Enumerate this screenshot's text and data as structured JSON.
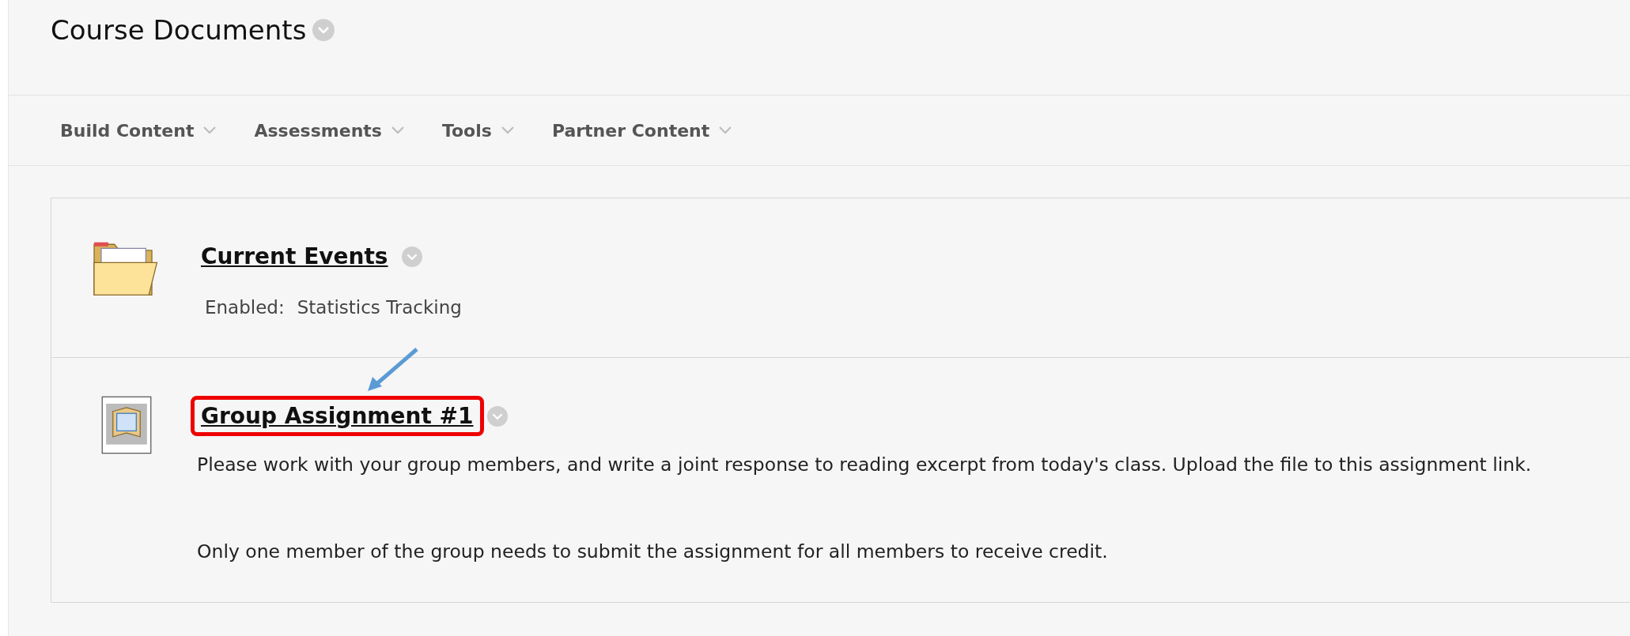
{
  "page_title": "Course Documents",
  "menu": [
    {
      "label": "Build Content"
    },
    {
      "label": "Assessments"
    },
    {
      "label": "Tools"
    },
    {
      "label": "Partner Content"
    }
  ],
  "items": [
    {
      "kind": "folder",
      "title": "Current Events",
      "highlighted": false,
      "details": [
        {
          "label": "Enabled:",
          "value": "Statistics Tracking"
        }
      ]
    },
    {
      "kind": "assignment",
      "title": "Group Assignment #1",
      "highlighted": true,
      "paragraphs": [
        "Please work with your group members, and write a joint response to reading excerpt from today's class.  Upload the file to this assignment link.",
        "Only one member of the group needs to submit the assignment for all members to receive credit."
      ]
    }
  ]
}
